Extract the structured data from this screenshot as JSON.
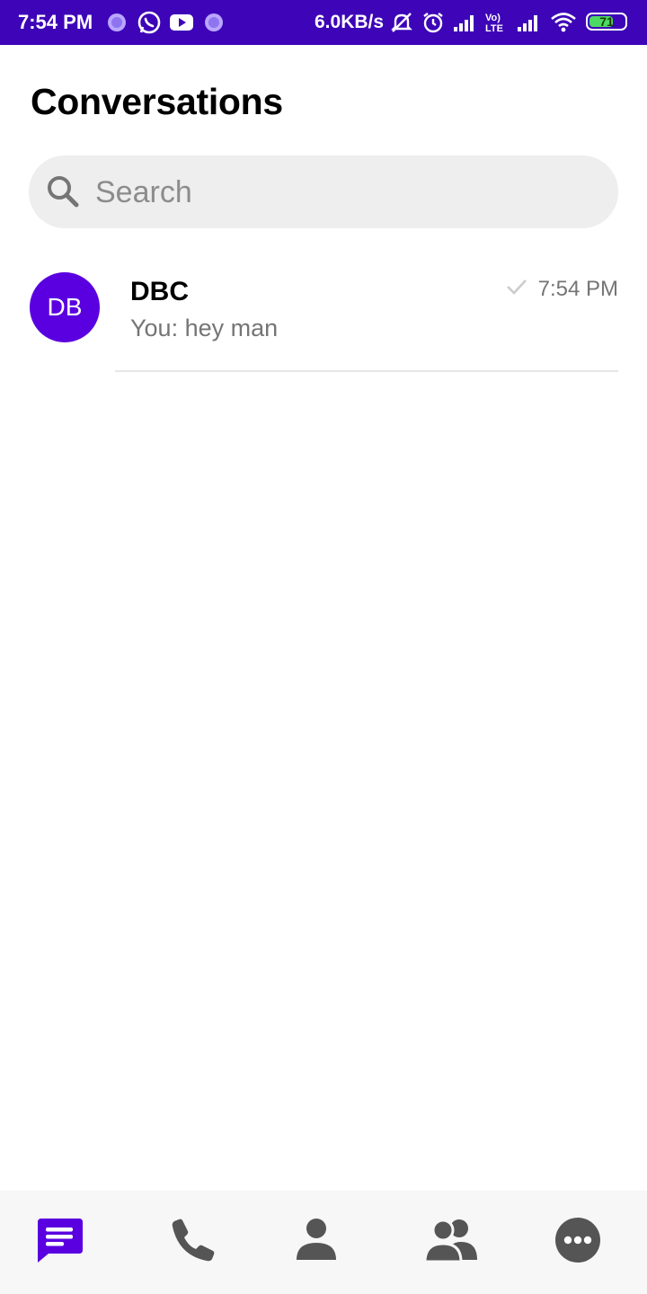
{
  "status_bar": {
    "time": "7:54 PM",
    "network_speed": "6.0KB/s",
    "battery_level": "71",
    "icons": [
      "generic-app-icon",
      "whatsapp-icon",
      "youtube-icon",
      "generic-app-icon",
      "mute-icon",
      "alarm-icon",
      "signal-icon",
      "volte-icon",
      "signal-icon",
      "wifi-icon",
      "battery-icon"
    ]
  },
  "header": {
    "title": "Conversations"
  },
  "search": {
    "placeholder": "Search",
    "value": ""
  },
  "conversations": [
    {
      "avatar_initials": "DB",
      "avatar_color": "#5a00e0",
      "name": "DBC",
      "preview": "You: hey man",
      "time": "7:54 PM",
      "status_icon": "check-icon"
    }
  ],
  "bottom_nav": {
    "items": [
      {
        "icon": "messages-icon",
        "active": true
      },
      {
        "icon": "phone-icon",
        "active": false
      },
      {
        "icon": "contact-icon",
        "active": false
      },
      {
        "icon": "group-icon",
        "active": false
      },
      {
        "icon": "more-icon",
        "active": false
      }
    ],
    "active_color": "#5a00e0",
    "inactive_color": "#555555"
  },
  "colors": {
    "status_bar": "#3d04b8",
    "accent": "#5a00e0"
  }
}
